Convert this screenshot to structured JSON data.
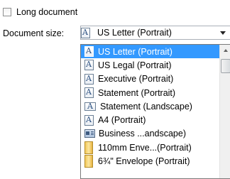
{
  "checkbox": {
    "label": "Long document",
    "checked": false
  },
  "document_size": {
    "label": "Document size:",
    "selected": "US Letter (Portrait)",
    "selected_icon": "portrait-document-icon",
    "options": [
      {
        "label": "US Letter (Portrait)",
        "icon": "portrait-document-icon",
        "selected": true
      },
      {
        "label": "US Legal (Portrait)",
        "icon": "portrait-document-icon",
        "selected": false
      },
      {
        "label": "Executive (Portrait)",
        "icon": "portrait-document-icon",
        "selected": false
      },
      {
        "label": "Statement (Portrait)",
        "icon": "portrait-document-icon",
        "selected": false
      },
      {
        "label": "Statement (Landscape)",
        "icon": "landscape-document-icon",
        "selected": false
      },
      {
        "label": "A4 (Portrait)",
        "icon": "portrait-document-icon",
        "selected": false
      },
      {
        "label": "Business ...andscape)",
        "icon": "business-card-icon",
        "selected": false
      },
      {
        "label": "110mm Enve...(Portrait)",
        "icon": "envelope-icon",
        "selected": false
      },
      {
        "label": "6¾\" Envelope (Portrait)",
        "icon": "envelope-icon",
        "selected": false
      }
    ]
  },
  "colors": {
    "selection": "#3399ff",
    "border": "#7a7a7a"
  }
}
